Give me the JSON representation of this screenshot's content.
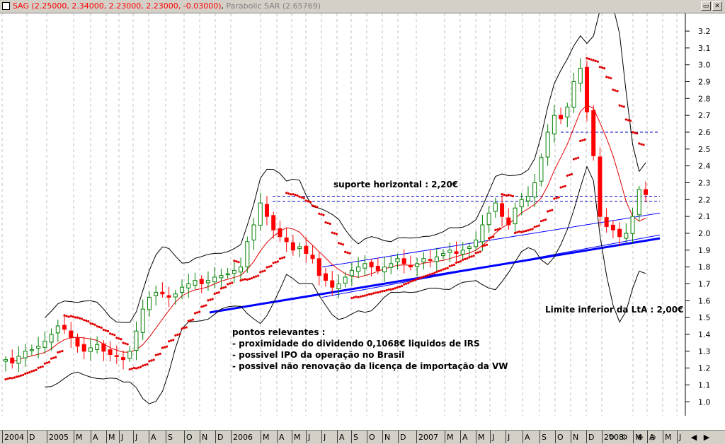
{
  "window": {
    "symbol_info": "SAG (2.25000, 2.34000, 2.23000, 2.23000, -0.03000)",
    "indicator_info": "Parabolic SAR (2.65769)",
    "buttons": [
      "restore",
      "close"
    ]
  },
  "annotations": {
    "support": "suporte horizontal : 2,20€",
    "limit": "Limite inferior da LtA : 2,00€",
    "points_title": "pontos relevantes :",
    "points": [
      "- proximidade do dividendo 0,1068€ liquidos de IRS",
      "- possivel IPO da operação no Brasil",
      "- possivel não renovação da licença de importação da VW"
    ]
  },
  "time_axis": [
    "2004",
    "D",
    "2005",
    "M",
    "A",
    "M",
    "J",
    "J",
    "A",
    "S",
    "O",
    "N",
    "D",
    "2006",
    "M",
    "A",
    "M",
    "J",
    "J",
    "A",
    "S",
    "O",
    "N",
    "D",
    "2007",
    "M",
    "A",
    "M",
    "J",
    "J",
    "A",
    "S",
    "O",
    "N",
    "D",
    "2008",
    "M",
    "A",
    "M",
    "J"
  ],
  "nav_controls": [
    "↻",
    "⚙",
    "⊕",
    "⊖",
    "◀",
    "▶"
  ],
  "colors": {
    "up": "#008000",
    "down": "#ff0000",
    "sar": "#e00000",
    "trend": "#0000ff",
    "bands": "#000000",
    "ma": "#e00000"
  },
  "chart_data": {
    "type": "candlestick",
    "title": "SAG",
    "interval": "weekly",
    "x_range": [
      "2004-11",
      "2008-06"
    ],
    "y_ticks": [
      1.0,
      1.1,
      1.2,
      1.3,
      1.4,
      1.5,
      1.6,
      1.7,
      1.8,
      1.9,
      2.0,
      2.1,
      2.2,
      2.3,
      2.4,
      2.5,
      2.6,
      2.7,
      2.8,
      2.9,
      3.0,
      3.1,
      3.2
    ],
    "ylim": [
      0.95,
      3.27
    ],
    "last_bar": {
      "open": 2.25,
      "high": 2.34,
      "low": 2.23,
      "close": 2.23,
      "change": -0.03
    },
    "parabolic_sar_last": 2.65769,
    "horizontal_lines": [
      2.19,
      2.22,
      2.6
    ],
    "candle_path": [
      1.25,
      1.23,
      1.27,
      1.3,
      1.31,
      1.33,
      1.36,
      1.4,
      1.45,
      1.43,
      1.38,
      1.33,
      1.3,
      1.32,
      1.34,
      1.3,
      1.28,
      1.27,
      1.25,
      1.3,
      1.42,
      1.55,
      1.62,
      1.65,
      1.64,
      1.62,
      1.64,
      1.68,
      1.7,
      1.72,
      1.7,
      1.72,
      1.74,
      1.75,
      1.76,
      1.78,
      1.8,
      1.95,
      2.05,
      2.18,
      2.1,
      2.02,
      1.98,
      1.95,
      1.9,
      1.92,
      1.88,
      1.85,
      1.75,
      1.72,
      1.68,
      1.7,
      1.74,
      1.78,
      1.8,
      1.82,
      1.8,
      1.78,
      1.8,
      1.82,
      1.85,
      1.82,
      1.8,
      1.82,
      1.85,
      1.84,
      1.86,
      1.88,
      1.9,
      1.88,
      1.9,
      1.92,
      1.96,
      2.05,
      2.12,
      2.18,
      2.1,
      2.05,
      2.15,
      2.2,
      2.22,
      2.3,
      2.45,
      2.6,
      2.7,
      2.68,
      2.75,
      2.9,
      2.98,
      2.72,
      2.46,
      2.1,
      2.04,
      2.02,
      1.98,
      2.0,
      2.1,
      2.26,
      2.23
    ],
    "trendlines": [
      {
        "name": "LtA",
        "from": [
          "2006-01",
          1.53
        ],
        "to": [
          "2008-04",
          1.97
        ]
      },
      {
        "from": [
          "2006-07",
          1.62
        ],
        "to": [
          "2008-04",
          1.99
        ]
      },
      {
        "from": [
          "2006-07",
          1.8
        ],
        "to": [
          "2008-04",
          2.12
        ]
      }
    ]
  }
}
